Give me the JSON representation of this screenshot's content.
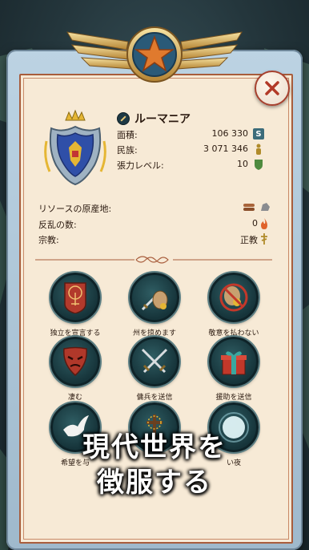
{
  "country": {
    "name": "ルーマニア",
    "stats": [
      {
        "label": "面積:",
        "value": "106 330",
        "icon": "area-icon"
      },
      {
        "label": "民族:",
        "value": "3 071 346",
        "icon": "population-icon"
      },
      {
        "label": "張力レベル:",
        "value": "10",
        "icon": "tension-icon"
      }
    ]
  },
  "details": {
    "resources_label": "リソースの原産地:",
    "rebellions_label": "反乱の数:",
    "rebellions_value": "0",
    "religion_label": "宗教:",
    "religion_value": "正教"
  },
  "actions": [
    {
      "label": "独立を宣言する",
      "icon": "tree-emblem-icon"
    },
    {
      "label": "州を掠めます",
      "icon": "sword-and-sack-icon"
    },
    {
      "label": "敬意を払わない",
      "icon": "no-gold-icon"
    },
    {
      "label": "凄む",
      "icon": "mask-icon"
    },
    {
      "label": "傭兵を送信",
      "icon": "crossed-swords-icon"
    },
    {
      "label": "援助を送信",
      "icon": "gift-icon"
    },
    {
      "label": "希望を与",
      "icon": "dove-icon"
    },
    {
      "label": "",
      "icon": "thorned-cross-icon"
    },
    {
      "label": "い夜",
      "icon": "moon-icon"
    }
  ],
  "promo": {
    "line1": "現代世界を",
    "line2": "徴服する"
  },
  "colors": {
    "parchment": "#f7ead6",
    "border": "#a85d3c",
    "button": "#16343a",
    "close": "#a6402e"
  }
}
